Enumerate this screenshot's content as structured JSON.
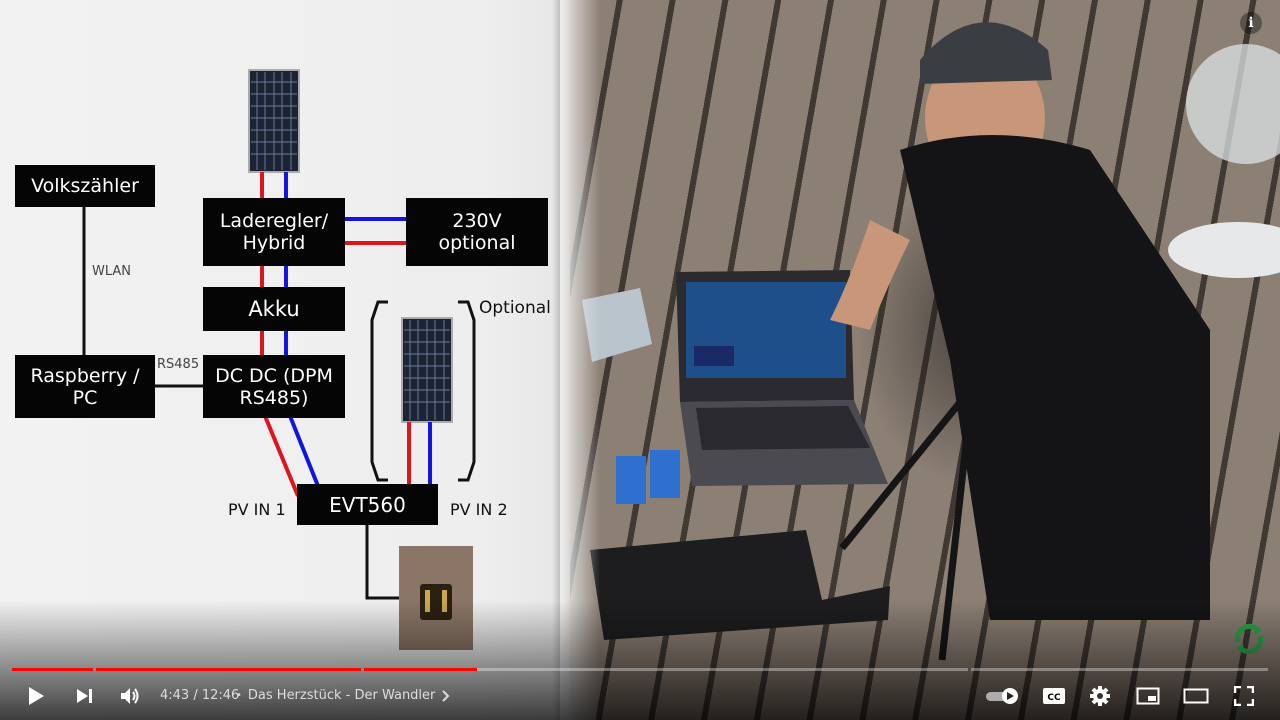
{
  "diagram": {
    "boxes": {
      "volkszaehler": "Volkszähler",
      "laderegler": "Laderegler/\nHybrid",
      "v230": "230V\noptional",
      "akku": "Akku",
      "raspberry": "Raspberry /\nPC",
      "dcdc": "DC DC (DPM\nRS485)",
      "evt560": "EVT560"
    },
    "labels": {
      "wlan": "WLAN",
      "rs485": "RS485",
      "optional": "Optional",
      "pv_in_1": "PV IN 1",
      "pv_in_2": "PV IN 2"
    },
    "colors": {
      "positive": "#e0141e",
      "negative": "#1414e0",
      "box": "#050505"
    }
  },
  "player": {
    "time_current": "4:43",
    "time_separator": " / ",
    "time_total": "12:46",
    "chapter_separator": "•",
    "chapter_title": "Das Herzstück - Der Wandler",
    "progress": {
      "played_fraction": 0.37,
      "accent_color": "#ff0000"
    },
    "icons": {
      "play": "play-icon",
      "next": "next-icon",
      "volume": "volume-icon",
      "chapter_chevron": "chevron-right-icon",
      "autoplay": "autoplay-toggle-icon",
      "subtitles": "cc-icon",
      "settings": "gear-icon",
      "miniplayer": "miniplayer-icon",
      "theater": "theater-icon",
      "fullscreen": "fullscreen-icon",
      "info": "info-icon"
    }
  }
}
